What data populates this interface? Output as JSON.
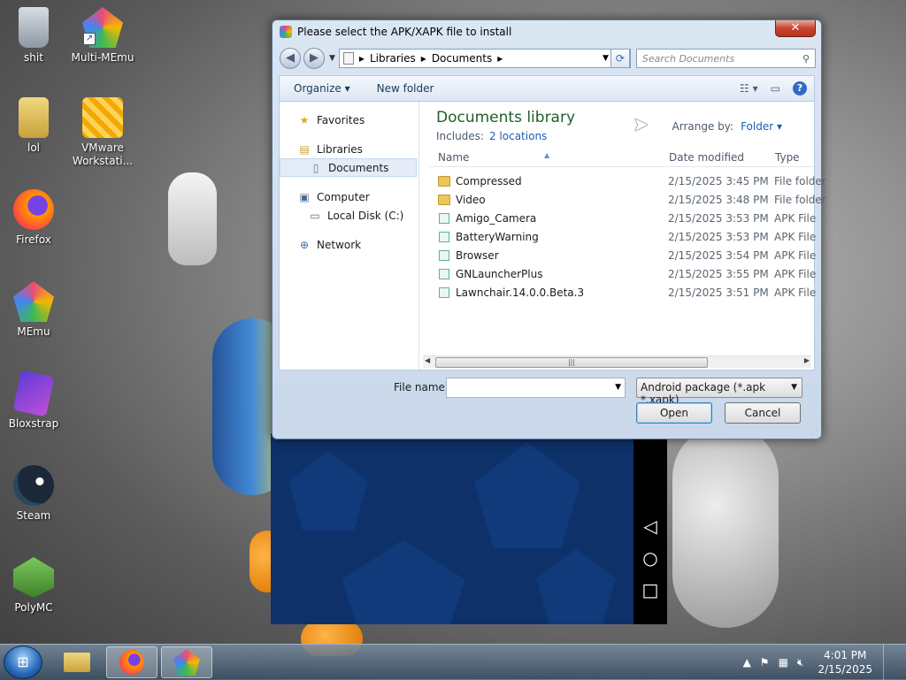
{
  "desktop": {
    "icons": [
      {
        "label": "shit",
        "color": "#9aa3ad"
      },
      {
        "label": "Multi-MEmu",
        "color": "#4d8de8"
      },
      {
        "label": "lol",
        "color": "#d9b44a"
      },
      {
        "label": "VMware Workstati...",
        "color": "#f2a900"
      },
      {
        "label": "Firefox",
        "color": "#ff7139"
      },
      {
        "label": "MEmu",
        "color": "#6f7bff"
      },
      {
        "label": "Bloxstrap",
        "color": "#8a4bd6"
      },
      {
        "label": "Steam",
        "color": "#1b2838"
      },
      {
        "label": "PolyMC",
        "color": "#5fae3e"
      }
    ]
  },
  "dialog": {
    "title": "Please select the APK/XAPK file to install",
    "close_label": "✕",
    "address": {
      "crumbs": [
        "Libraries",
        "Documents"
      ]
    },
    "search_placeholder": "Search Documents",
    "toolbar": {
      "organize": "Organize ▾",
      "new_folder": "New folder"
    },
    "nav": {
      "favorites": "Favorites",
      "libraries": "Libraries",
      "documents": "Documents",
      "computer": "Computer",
      "local_disk": "Local Disk (C:)",
      "network": "Network"
    },
    "library": {
      "title": "Documents library",
      "includes_label": "Includes:",
      "includes_link": "2 locations",
      "arrange_label": "Arrange by:",
      "arrange_value": "Folder ▾"
    },
    "columns": {
      "name": "Name",
      "date": "Date modified",
      "type": "Type"
    },
    "files": [
      {
        "name": "Compressed",
        "date": "2/15/2025 3:45 PM",
        "type": "File folder",
        "kind": "folder"
      },
      {
        "name": "Video",
        "date": "2/15/2025 3:48 PM",
        "type": "File folder",
        "kind": "folder"
      },
      {
        "name": "Amigo_Camera",
        "date": "2/15/2025 3:53 PM",
        "type": "APK File",
        "kind": "apk"
      },
      {
        "name": "BatteryWarning",
        "date": "2/15/2025 3:53 PM",
        "type": "APK File",
        "kind": "apk"
      },
      {
        "name": "Browser",
        "date": "2/15/2025 3:54 PM",
        "type": "APK File",
        "kind": "apk"
      },
      {
        "name": "GNLauncherPlus",
        "date": "2/15/2025 3:55 PM",
        "type": "APK File",
        "kind": "apk"
      },
      {
        "name": "Lawnchair.14.0.0.Beta.3",
        "date": "2/15/2025 3:51 PM",
        "type": "APK File",
        "kind": "apk"
      }
    ],
    "file_name_label": "File name:",
    "file_name_value": "",
    "file_type_selected": "Android package (*.apk *.xapk)",
    "open_label": "Open",
    "cancel_label": "Cancel"
  },
  "taskbar": {
    "clock_time": "4:01 PM",
    "clock_date": "2/15/2025"
  },
  "colors": {
    "library_title": "#1e5f28",
    "link": "#1f5db3"
  }
}
